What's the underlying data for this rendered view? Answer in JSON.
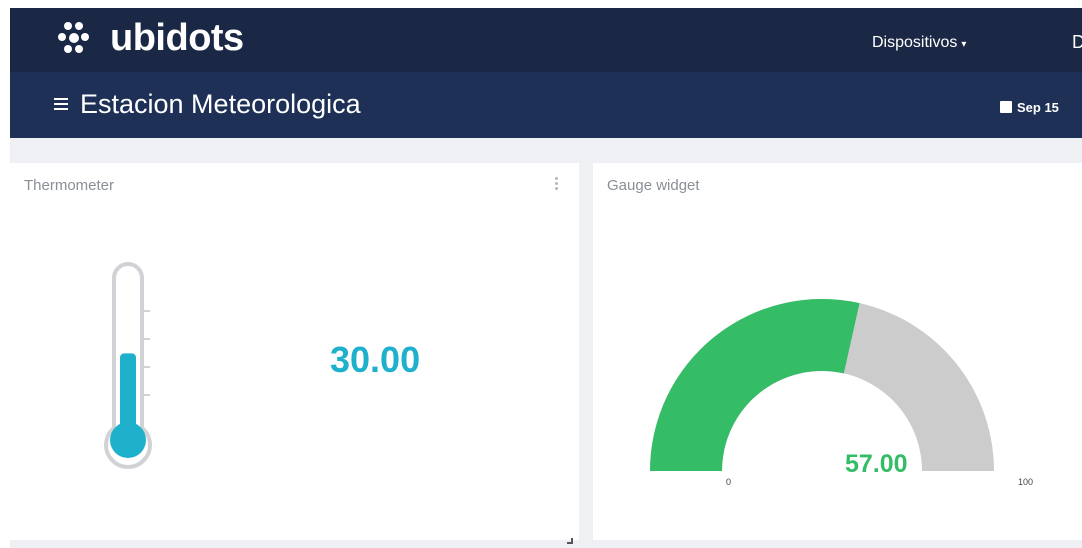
{
  "brand": {
    "name": "ubidots"
  },
  "nav": {
    "devices_label": "Dispositivos",
    "more_label": "D"
  },
  "dashboard": {
    "title": "Estacion Meteorologica",
    "date_range_label": "Sep 15"
  },
  "widgets": {
    "thermometer": {
      "title": "Thermometer",
      "value_label": "30.00",
      "fill_fraction": 0.35,
      "color": "#1fb1cc"
    },
    "gauge": {
      "title": "Gauge widget",
      "value_label": "57.00",
      "value": 57,
      "min_label": "0",
      "max_label": "100",
      "min": 0,
      "max": 100,
      "color_fill": "#34bc66",
      "color_rest": "#cccccc"
    }
  },
  "icons": [
    "logo-dots-icon",
    "caret-down-icon",
    "menu-icon",
    "calendar-icon",
    "kebab-menu-icon",
    "resize-handle-icon"
  ]
}
